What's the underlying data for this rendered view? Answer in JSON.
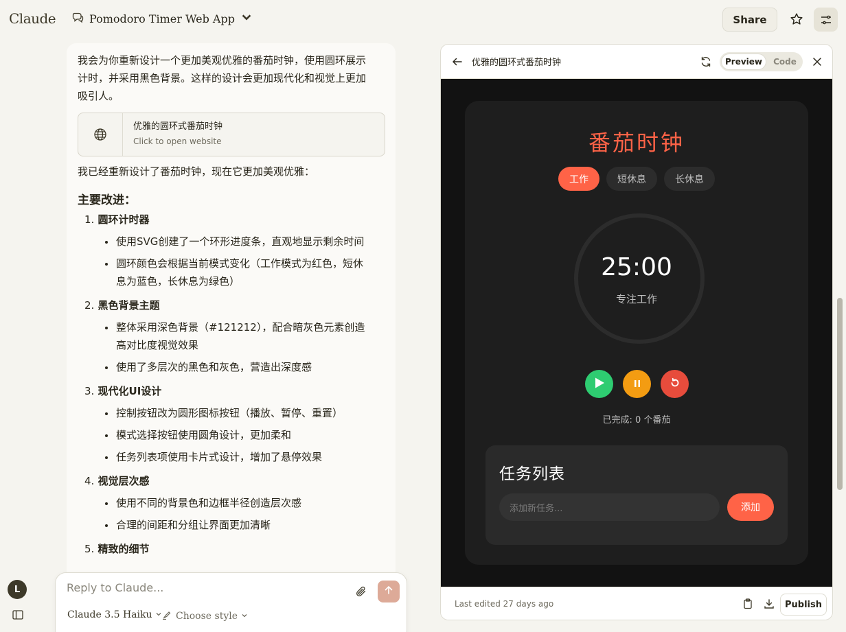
{
  "app": {
    "logo": "Claude"
  },
  "header": {
    "project_title": "Pomodoro Timer Web App",
    "share_label": "Share"
  },
  "message": {
    "intro": "我会为你重新设计一个更加美观优雅的番茄时钟，使用圆环展示计时，并采用黑色背景。这样的设计会更加现代化和视觉上更加吸引人。",
    "artifact_card": {
      "title": "优雅的圆环式番茄时钟",
      "subtitle": "Click to open website"
    },
    "after_card": "我已经重新设计了番茄时钟，现在它更加美观优雅：",
    "heading": "主要改进：",
    "sections": [
      {
        "num": "1.",
        "title": "圆环计时器",
        "bullets": [
          "使用SVG创建了一个环形进度条，直观地显示剩余时间",
          "圆环颜色会根据当前模式变化（工作模式为红色，短休息为蓝色，长休息为绿色）"
        ]
      },
      {
        "num": "2.",
        "title": "黑色背景主题",
        "bullets": [
          "整体采用深色背景（#121212），配合暗灰色元素创造高对比度视觉效果",
          "使用了多层次的黑色和灰色，营造出深度感"
        ]
      },
      {
        "num": "3.",
        "title": "现代化UI设计",
        "bullets": [
          "控制按钮改为圆形图标按钮（播放、暂停、重置）",
          "模式选择按钮使用圆角设计，更加柔和",
          "任务列表项使用卡片式设计，增加了悬停效果"
        ]
      },
      {
        "num": "4.",
        "title": "视觉层次感",
        "bullets": [
          "使用不同的背景色和边框半径创造层次感",
          "合理的间距和分组让界面更加清晰"
        ]
      },
      {
        "num": "5.",
        "title": "精致的细节",
        "bullets": []
      }
    ]
  },
  "composer": {
    "placeholder": "Reply to Claude...",
    "model": "Claude 3.5 Haiku",
    "style": "Choose style",
    "avatar_initial": "L"
  },
  "panel": {
    "title": "优雅的圆环式番茄时钟",
    "toggle_preview": "Preview",
    "toggle_code": "Code",
    "footer_edited": "Last edited 27 days ago",
    "publish_label": "Publish"
  },
  "pomodoro": {
    "title": "番茄时钟",
    "modes": [
      "工作",
      "短休息",
      "长休息"
    ],
    "active_mode": 0,
    "time": "25:00",
    "status": "专注工作",
    "completed": "已完成: 0 个番茄",
    "tasks_title": "任务列表",
    "task_placeholder": "添加新任务...",
    "add_label": "添加",
    "colors": {
      "accent": "#ff6347",
      "play": "#2ecc71",
      "pause": "#f39c12",
      "reset": "#e74c3c",
      "background": "#121212"
    }
  }
}
